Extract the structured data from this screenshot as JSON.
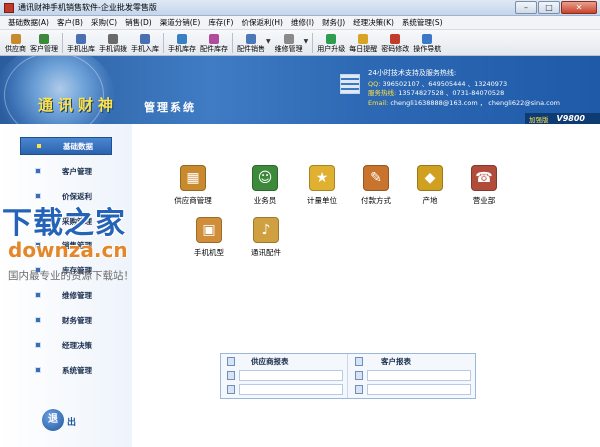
{
  "window": {
    "title": "通讯财神手机销售软件-企业批发零售版",
    "buttons": [
      "–",
      "□",
      "✕"
    ]
  },
  "menu": [
    "基础数据(A)",
    "客户(B)",
    "采购(C)",
    "销售(D)",
    "渠道分销(E)",
    "库存(F)",
    "价保返利(H)",
    "维修(I)",
    "财务(J)",
    "经理决策(K)",
    "系统管理(S)"
  ],
  "toolbar": [
    {
      "label": "供应商",
      "icon": "supplier-icon",
      "color": "#c98a2e"
    },
    {
      "label": "客户管理",
      "icon": "customer-icon",
      "color": "#3d8a3a"
    },
    {
      "label": "手机出库",
      "icon": "phone-out-icon",
      "color": "#4b6fb3"
    },
    {
      "label": "手机调拨",
      "icon": "phone-transfer-icon",
      "color": "#6a6a6a"
    },
    {
      "label": "手机入库",
      "icon": "phone-in-icon",
      "color": "#4b6fb3"
    },
    {
      "label": "手机库存",
      "icon": "phone-stock-icon",
      "color": "#3a7fc4"
    },
    {
      "label": "配件库存",
      "icon": "parts-stock-icon",
      "color": "#b14b9b"
    },
    {
      "label": "配件销售",
      "icon": "parts-sales-icon",
      "color": "#4a78b8",
      "dropdown": true
    },
    {
      "label": "维修管理",
      "icon": "repair-icon",
      "color": "#8a8a8a",
      "dropdown": true
    },
    {
      "label": "用户升级",
      "icon": "upgrade-icon",
      "color": "#2f9c4f"
    },
    {
      "label": "每日提醒",
      "icon": "reminder-icon",
      "color": "#d9a423"
    },
    {
      "label": "密码修改",
      "icon": "password-icon",
      "color": "#c23b2b"
    },
    {
      "label": "操作导航",
      "icon": "navigation-icon",
      "color": "#3c78c8"
    }
  ],
  "banner": {
    "brand": "通讯财神",
    "brand_sub": "管理系统",
    "support_title": "24小时技术支持及服务热线:",
    "qq_label": "QQ:",
    "qq": "396502107 、649505444 、13240973",
    "hotline_label": "服务热线:",
    "hotline": "13574827528 、0731-84070528",
    "email_label": "Email:",
    "email": "chengli1638888@163.com ， chengli622@sina.com",
    "edition_tag": "加强版",
    "version": "V9800"
  },
  "sidebar": {
    "items": [
      {
        "label": "基础数据",
        "active": true
      },
      {
        "label": "客户管理"
      },
      {
        "label": "价保返利"
      },
      {
        "label": "采购管理"
      },
      {
        "label": "销售管理"
      },
      {
        "label": "库存管理"
      },
      {
        "label": "维修管理"
      },
      {
        "label": "财务管理"
      },
      {
        "label": "经理决策"
      },
      {
        "label": "系统管理"
      }
    ],
    "exit_glyph": "退",
    "exit_label": "出"
  },
  "modules": [
    {
      "label": "供应商管理",
      "icon": "supplier-manage-icon",
      "color": "#c98a2e",
      "glyph": "▦"
    },
    {
      "label": "业务员",
      "icon": "salesperson-icon",
      "color": "#3d8a3a",
      "glyph": "☺"
    },
    {
      "label": "计量单位",
      "icon": "unit-icon",
      "color": "#e0b030",
      "glyph": "★"
    },
    {
      "label": "付款方式",
      "icon": "payment-icon",
      "color": "#c9742e",
      "glyph": "✎"
    },
    {
      "label": "产地",
      "icon": "origin-icon",
      "color": "#d0a020",
      "glyph": "◆"
    },
    {
      "label": "营业部",
      "icon": "branch-icon",
      "color": "#b14b3a",
      "glyph": "☎"
    },
    {
      "label": "手机机型",
      "icon": "phone-model-icon",
      "color": "#d08e3a",
      "glyph": "▣"
    },
    {
      "label": "通讯配件",
      "icon": "parts-icon",
      "color": "#d0a040",
      "glyph": "♪"
    }
  ],
  "reports": {
    "left_title": "供应商报表",
    "right_title": "客户报表"
  },
  "watermark": {
    "big": "下载之家",
    "url": "downza.cn",
    "slogan": "国内最专业的资源下载站！"
  }
}
